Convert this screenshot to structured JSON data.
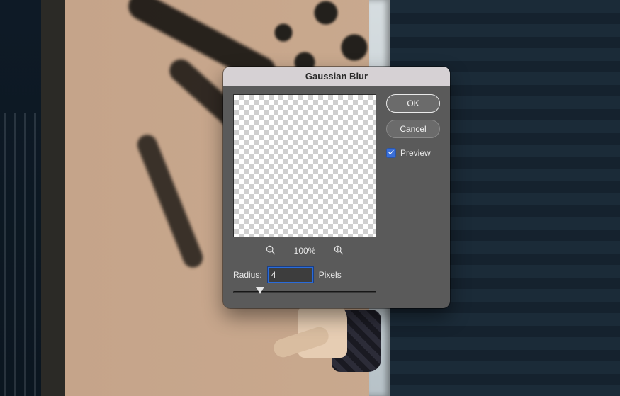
{
  "dialog": {
    "title": "Gaussian Blur",
    "ok_label": "OK",
    "cancel_label": "Cancel",
    "preview_label": "Preview",
    "preview_checked": true,
    "zoom_percent": "100%",
    "radius_label": "Radius:",
    "radius_value": "4",
    "radius_unit": "Pixels"
  },
  "icons": {
    "zoom_out": "zoom-out-icon",
    "zoom_in": "zoom-in-icon",
    "checkmark": "checkmark-icon"
  }
}
